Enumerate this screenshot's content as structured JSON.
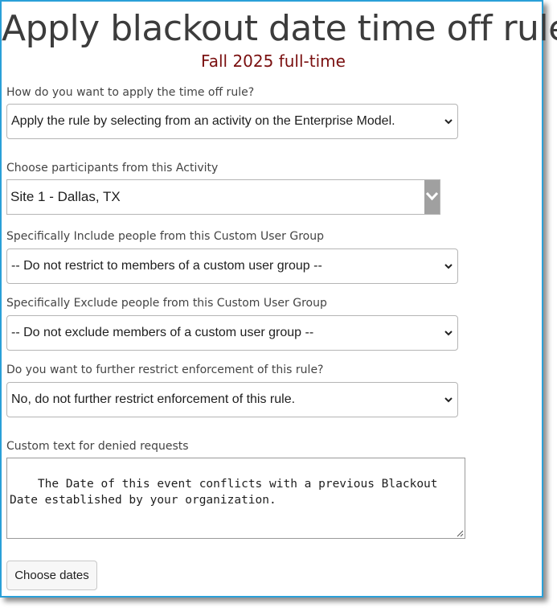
{
  "page": {
    "title": "Apply blackout date time off rule",
    "subtitle": "Fall 2025 full-time"
  },
  "fields": {
    "apply_method": {
      "label": "How do you want to apply the time off rule?",
      "value": "Apply the rule by selecting from an activity on the Enterprise Model."
    },
    "activity": {
      "label": "Choose participants from this Activity",
      "value": "Site 1 - Dallas, TX"
    },
    "include_group": {
      "label": "Specifically Include people from this Custom User Group",
      "value": "-- Do not restrict to members of a custom user group --"
    },
    "exclude_group": {
      "label": "Specifically Exclude people from this Custom User Group",
      "value": "-- Do not exclude members of a custom user group --"
    },
    "restrict_enforcement": {
      "label": "Do you want to further restrict enforcement of this rule?",
      "value": "No, do not further restrict enforcement of this rule."
    },
    "denied_text": {
      "label": "Custom text for denied requests",
      "value": "The Date of this event conflicts with a previous Blackout Date established by your organization."
    }
  },
  "actions": {
    "choose_dates_label": "Choose dates"
  },
  "colors": {
    "frame_border": "#2aa0d8",
    "title": "#3c3c3c",
    "subtitle": "#7a1010"
  }
}
